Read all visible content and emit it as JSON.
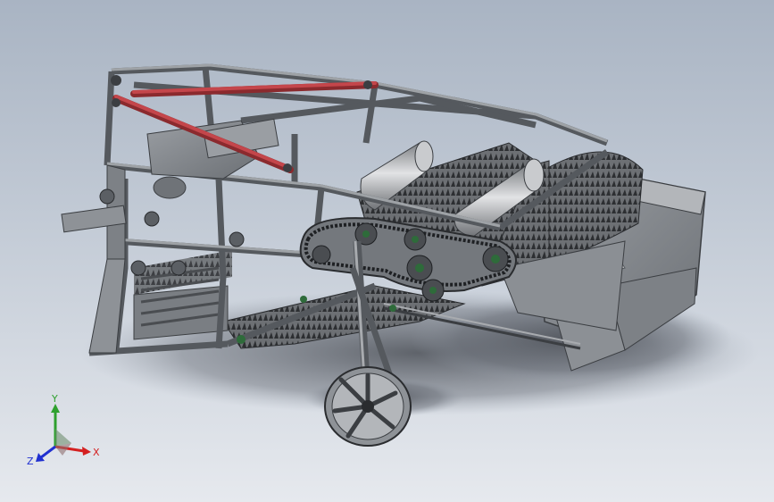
{
  "viewport": {
    "background_top": "#a9b4c3",
    "background_bottom": "#e6e9ee"
  },
  "model": {
    "frame_color": "#8e9297",
    "frame_dark": "#55595e",
    "link_color": "#b0353a",
    "roller_color": "#c6c8cb",
    "sprocket_color": "#2e6b3a"
  },
  "triad": {
    "x_label": "X",
    "y_label": "Y",
    "z_label": "Z",
    "x_color": "#d42020",
    "y_color": "#2ea02e",
    "z_color": "#2030d0"
  }
}
